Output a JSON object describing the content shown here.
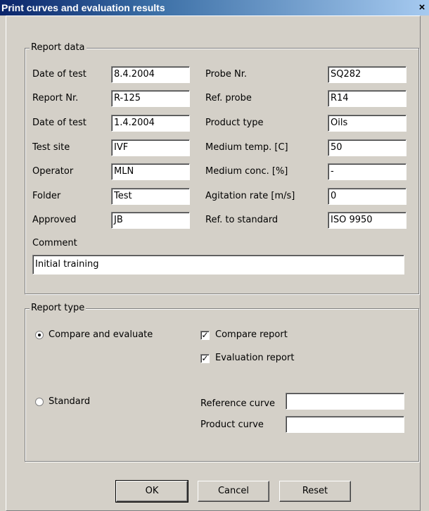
{
  "window": {
    "title": "Print curves and evaluation results",
    "close_glyph": "×"
  },
  "report_data": {
    "legend": "Report data",
    "left_fields": [
      {
        "label": "Date of test",
        "value": "8.4.2004"
      },
      {
        "label": "Report Nr.",
        "value": "R-125"
      },
      {
        "label": "Date of test",
        "value": "1.4.2004"
      },
      {
        "label": "Test site",
        "value": "IVF"
      },
      {
        "label": "Operator",
        "value": "MLN"
      },
      {
        "label": "Folder",
        "value": "Test"
      },
      {
        "label": "Approved",
        "value": "JB"
      }
    ],
    "right_fields": [
      {
        "label": "Probe Nr.",
        "value": "SQ282"
      },
      {
        "label": "Ref. probe",
        "value": "R14"
      },
      {
        "label": "Product type",
        "value": "Oils"
      },
      {
        "label": "Medium temp. [C]",
        "value": "50"
      },
      {
        "label": "Medium conc. [%]",
        "value": "-"
      },
      {
        "label": "Agitation rate [m/s]",
        "value": "0"
      },
      {
        "label": "Ref. to standard",
        "value": "ISO 9950"
      }
    ],
    "comment_label": "Comment",
    "comment_value": "Initial training"
  },
  "report_type": {
    "legend": "Report type",
    "option_compare": {
      "label": "Compare and evaluate",
      "selected": true
    },
    "option_standard": {
      "label": "Standard",
      "selected": false
    },
    "compare_report": {
      "label": "Compare report",
      "checked": true
    },
    "evaluation_report": {
      "label": "Evaluation report",
      "checked": true
    },
    "reference_curve": {
      "label": "Reference curve",
      "value": ""
    },
    "product_curve": {
      "label": "Product curve",
      "value": ""
    }
  },
  "buttons": {
    "ok": "OK",
    "cancel": "Cancel",
    "reset": "Reset"
  },
  "glyphs": {
    "check": "✓"
  }
}
